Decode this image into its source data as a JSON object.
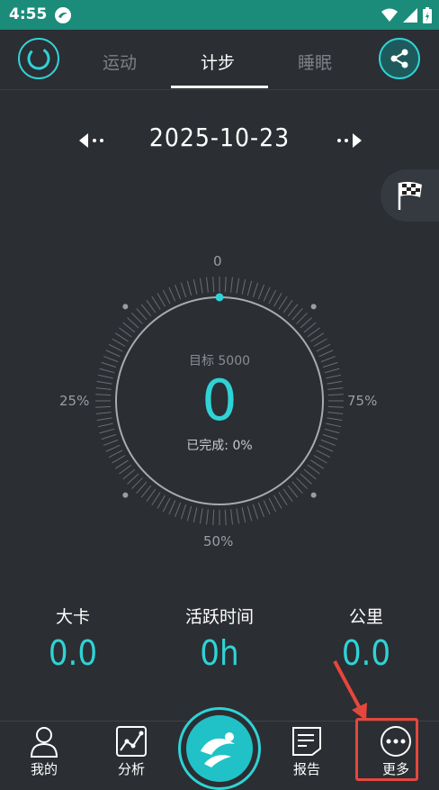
{
  "status_bar": {
    "time": "4:55"
  },
  "tabs": [
    {
      "label": "运动",
      "active": false
    },
    {
      "label": "计步",
      "active": true
    },
    {
      "label": "睡眠",
      "active": false
    }
  ],
  "date": "2025-10-23",
  "dial": {
    "top_label": "0",
    "left_label": "25%",
    "right_label": "75%",
    "bottom_label": "50%",
    "goal_text": "目标 5000",
    "steps": "0",
    "completed_text": "已完成: 0%",
    "progress": 0
  },
  "stats": [
    {
      "label": "大卡",
      "value": "0.0"
    },
    {
      "label": "活跃时间",
      "value": "0h"
    },
    {
      "label": "公里",
      "value": "0.0"
    }
  ],
  "bottom_nav": [
    {
      "label": "我的",
      "icon": "person-icon"
    },
    {
      "label": "分析",
      "icon": "chart-icon"
    },
    {
      "label": "报告",
      "icon": "report-icon"
    },
    {
      "label": "更多",
      "icon": "more-icon"
    }
  ],
  "colors": {
    "accent": "#2fd3d6",
    "background": "#2b2e33",
    "statusbar": "#1b8b7a",
    "highlight": "#e6473c"
  }
}
